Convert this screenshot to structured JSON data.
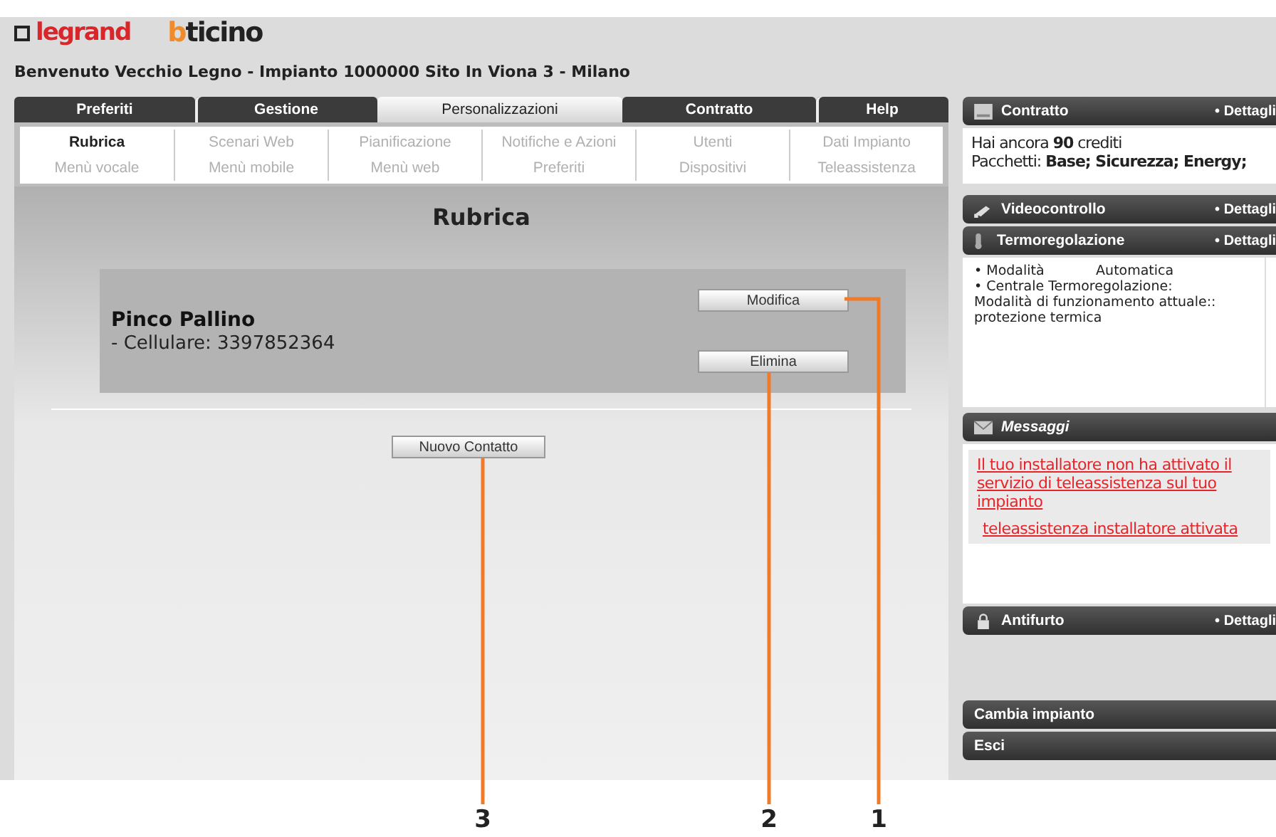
{
  "logos": [
    {
      "kind": "legrand",
      "text": "legrand"
    },
    {
      "kind": "bticino",
      "text": "bticino"
    }
  ],
  "welcome": "Benvenuto Vecchio Legno - Impianto 1000000 Sito In Viona 3 - Milano",
  "tabs": [
    {
      "label": "Preferiti",
      "selected": false
    },
    {
      "label": "Gestione",
      "selected": false
    },
    {
      "label": "Personalizzazioni",
      "selected": true
    },
    {
      "label": "Contratto",
      "selected": false
    },
    {
      "label": "Help",
      "selected": false
    }
  ],
  "submenu": [
    [
      {
        "label": "Rubrica",
        "selected": true
      },
      {
        "label": "Scenari Web",
        "selected": false
      },
      {
        "label": "Pianificazione",
        "selected": false
      },
      {
        "label": "Notifiche e Azioni",
        "selected": false
      },
      {
        "label": "Utenti",
        "selected": false
      },
      {
        "label": "Dati Impianto",
        "selected": false
      }
    ],
    [
      {
        "label": "Menù vocale",
        "selected": false
      },
      {
        "label": "Menù mobile",
        "selected": false
      },
      {
        "label": "Menù web",
        "selected": false
      },
      {
        "label": "Preferiti",
        "selected": false
      },
      {
        "label": "Dispositivi",
        "selected": false
      },
      {
        "label": "Teleassistenza",
        "selected": false
      }
    ]
  ],
  "page_title": "Rubrica",
  "contact": {
    "name": "Pinco Pallino",
    "detail": "- Cellulare: 3397852364",
    "buttons": [
      "Modifica",
      "Elimina"
    ]
  },
  "new_contact_button": "Nuovo Contatto",
  "sidebar": [
    {
      "kind": "document",
      "title": "Contratto",
      "link": "• Dettagli",
      "body": {
        "kind": "text",
        "lines": [
          "Hai ancora **90** crediti",
          "Pacchetti: **Base; Sicurezza; Energy;**"
        ]
      }
    },
    {
      "kind": "camera",
      "title": "Videocontrollo",
      "link": "• Dettagli"
    },
    {
      "kind": "thermometer",
      "title": "Termoregolazione",
      "link": "• Dettagli",
      "body": {
        "kind": "small",
        "lines": [
          "• Modalità            Automatica",
          "• Centrale Termoregolazione:",
          "Modalità di funzionamento attuale:: protezione termica"
        ]
      }
    },
    {
      "kind": "envelope",
      "title": "Messaggi",
      "body": {
        "kind": "links",
        "lines": [
          "Il tuo installatore non ha attivato il servizio di teleassistenza sul tuo impianto",
          "teleassistenza installatore attivata"
        ]
      }
    },
    {
      "kind": "lock",
      "title": "Antifurto",
      "link": "• Dettagli"
    },
    {
      "kind": "plain",
      "title": "Cambia impianto"
    },
    {
      "kind": "plain",
      "title": "Esci"
    }
  ],
  "callouts": [
    {
      "label": "3"
    },
    {
      "label": "2"
    },
    {
      "label": "1"
    }
  ]
}
